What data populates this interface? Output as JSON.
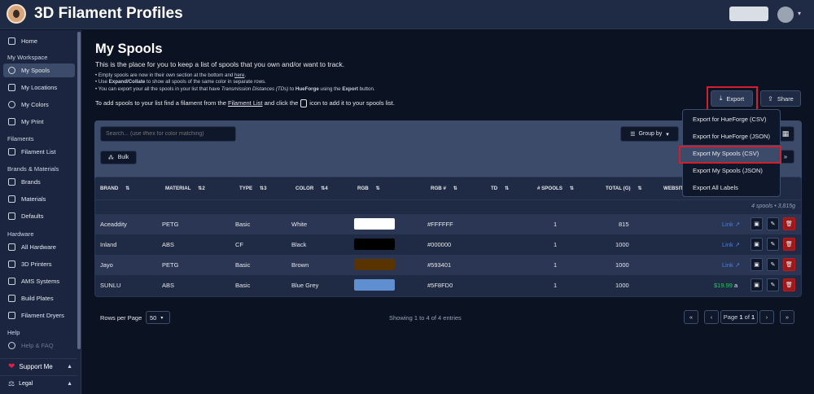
{
  "app": {
    "title": "3D Filament Profiles"
  },
  "sidebar": {
    "home": "Home",
    "workspace_section": "My Workspace",
    "workspace": [
      "My Spools",
      "My Locations",
      "My Colors",
      "My Print"
    ],
    "filaments_section": "Filaments",
    "filaments": [
      "Filament List"
    ],
    "brands_section": "Brands & Materials",
    "brands": [
      "Brands",
      "Materials",
      "Defaults"
    ],
    "hardware_section": "Hardware",
    "hardware": [
      "All Hardware",
      "3D Printers",
      "AMS Systems",
      "Build Plates",
      "Filament Dryers"
    ],
    "help_section": "Help",
    "help": [
      "Help & FAQ"
    ],
    "support": "Support Me",
    "legal": "Legal"
  },
  "page": {
    "title": "My Spools",
    "intro": "This is the place for you to keep a list of spools that you own and/or want to track.",
    "bullet1_a": "Empty spools are now in their own section at the bottom and ",
    "bullet1_link": "here",
    "bullet1_b": ".",
    "bullet2_a": "Use ",
    "bullet2_bold": "Expand/Collate",
    "bullet2_b": " to show all spools of the same color in separate rows.",
    "bullet3_a": "You can export your all the spools in your list that have ",
    "bullet3_italic": "Transmission Distances (TDs)",
    "bullet3_b": " to ",
    "bullet3_bold1": "HueForge",
    "bullet3_c": " using the ",
    "bullet3_bold2": "Export",
    "bullet3_d": " button.",
    "add_a": "To add spools to your list find a filament from the ",
    "add_link": "Filament List",
    "add_b": " and click the",
    "add_c": "icon to add it to your spools list."
  },
  "toolbar": {
    "export": "Export",
    "share": "Share",
    "search_placeholder": "Search... (use #hex for color matching)",
    "bulk": "Bulk",
    "group_by": "Group by"
  },
  "export_menu": [
    "Export for HueForge (CSV)",
    "Export for HueForge (JSON)",
    "Export My Spools (CSV)",
    "Export My Spools (JSON)",
    "Export All Labels"
  ],
  "table": {
    "columns": [
      "BRAND",
      "MATERIAL",
      "TYPE",
      "COLOR",
      "RGB",
      "RGB #",
      "TD",
      "# SPOOLS",
      "TOTAL (G)",
      "WEBSIT"
    ],
    "sort_marks": [
      "⇅",
      "⇅2",
      "⇅3",
      "⇅4",
      "⇅",
      "⇅",
      "⇅",
      "⇅",
      "⇅"
    ],
    "summary": "4 spools • 3,815g",
    "rows": [
      {
        "brand": "Aceaddity",
        "material": "PETG",
        "type": "Basic",
        "color": "White",
        "rgb": "#FFFFFF",
        "spools": "1",
        "total": "815",
        "link": "Link"
      },
      {
        "brand": "Inland",
        "material": "ABS",
        "type": "CF",
        "color": "Black",
        "rgb": "#000000",
        "spools": "1",
        "total": "1000",
        "link": "Link"
      },
      {
        "brand": "Jayo",
        "material": "PETG",
        "type": "Basic",
        "color": "Brown",
        "rgb": "#593401",
        "spools": "1",
        "total": "1000",
        "link": "Link"
      },
      {
        "brand": "SUNLU",
        "material": "ABS",
        "type": "Basic",
        "color": "Blue Grey",
        "rgb": "#5F8FD0",
        "spools": "1",
        "total": "1000",
        "price": "$19.99"
      }
    ]
  },
  "pagination": {
    "rows_label": "Rows per Page",
    "rows_value": "50",
    "showing": "Showing 1 to 4 of 4 entries",
    "page_word": "Page",
    "page_current": "1",
    "page_of": "of",
    "page_total": "1"
  },
  "colors": {
    "accent": "#3d4b6b",
    "highlight": "#d21f2f",
    "link": "#3b82f6",
    "price": "#22c55e",
    "delete": "#991b1b"
  }
}
